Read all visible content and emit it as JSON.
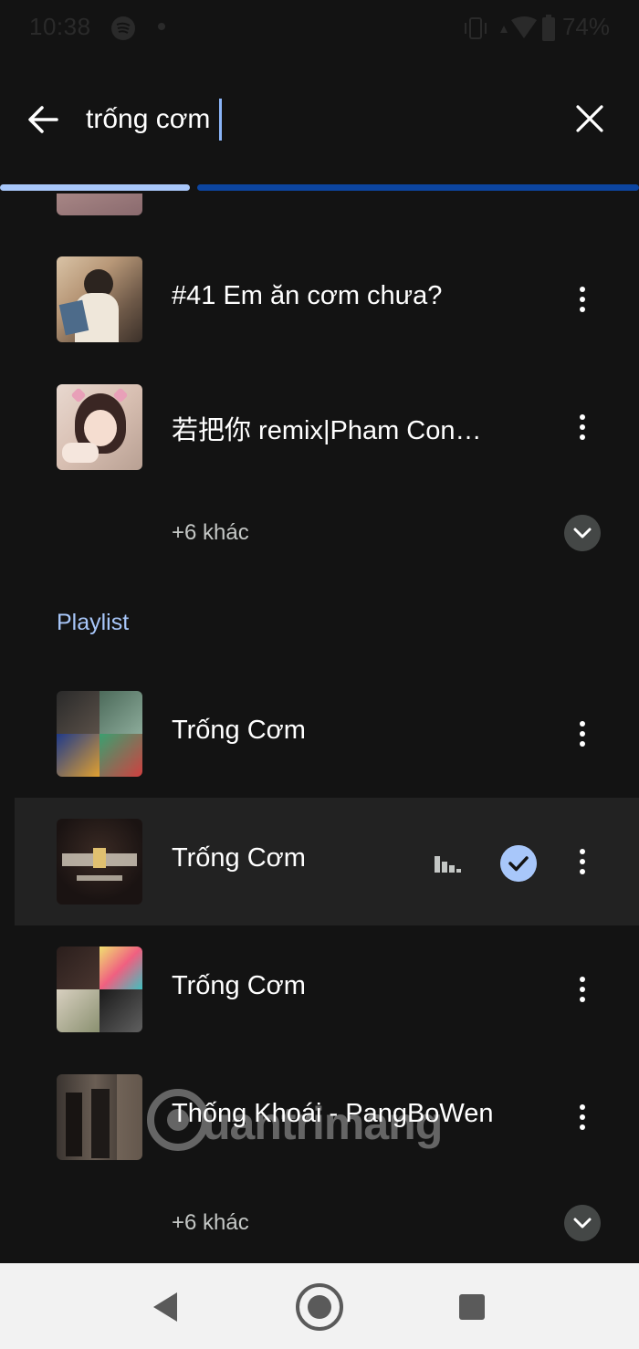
{
  "status_bar": {
    "time": "10:38",
    "battery": "74%",
    "icons": [
      "spotify-icon",
      "dot-icon",
      "vibrate-icon",
      "wifi-icon",
      "battery-icon"
    ]
  },
  "search": {
    "query": "trống cơm",
    "back_icon": "arrow-back-icon",
    "clear_icon": "close-icon"
  },
  "songs": {
    "items": [
      {
        "title": "#41 Em ăn cơm chưa?"
      },
      {
        "title": "若把你 remix|Pham Con…"
      }
    ],
    "more_label": "+6 khác"
  },
  "playlists": {
    "header": "Playlist",
    "items": [
      {
        "title": "Trống Cơm",
        "selected": false
      },
      {
        "title": "Trống Cơm",
        "selected": true,
        "playing": true
      },
      {
        "title": "Trống Cơm",
        "selected": false
      },
      {
        "title": "Thống Khoái - PangBoWen",
        "selected": false
      }
    ],
    "more_label": "+6 khác"
  },
  "watermark": {
    "text": "uantrimang"
  },
  "colors": {
    "background": "#131313",
    "accent": "#a8c7fa",
    "selected_row": "#222222",
    "nav_bar": "#f2f2f2"
  },
  "nav": {
    "icons": [
      "back-triangle-icon",
      "home-circle-icon",
      "recents-square-icon"
    ]
  }
}
